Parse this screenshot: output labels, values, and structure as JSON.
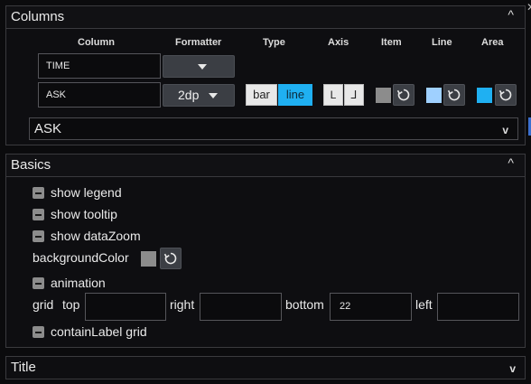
{
  "columns_panel": {
    "title": "Columns",
    "headers": {
      "column": "Column",
      "formatter": "Formatter",
      "type": "Type",
      "axis": "Axis",
      "item": "Item",
      "line": "Line",
      "area": "Area"
    },
    "rows": [
      {
        "column": "TIME",
        "formatter": ""
      },
      {
        "column": "ASK",
        "formatter": "2dp",
        "type_options": [
          "bar",
          "line"
        ],
        "type_selected": "line",
        "axis_options": [
          "L",
          "⅃"
        ],
        "item_color": "#8c8c8c",
        "line_color": "#9fd0ff",
        "area_color": "#1fb0f2"
      }
    ],
    "selected_column": "ASK"
  },
  "basics_panel": {
    "title": "Basics",
    "show_legend": "show legend",
    "show_tooltip": "show tooltip",
    "show_datazoom": "show dataZoom",
    "background_color_label": "backgroundColor",
    "background_color": "#8c8c8c",
    "animation": "animation",
    "grid_label": "grid",
    "grid_top_label": "top",
    "grid_right_label": "right",
    "grid_bottom_label": "bottom",
    "grid_left_label": "left",
    "grid_top_value": "",
    "grid_right_value": "",
    "grid_bottom_value": "22",
    "grid_left_value": "",
    "contain_label_grid": "containLabel grid"
  },
  "title_panel": {
    "title": "Title"
  },
  "icons": {
    "collapse": "^",
    "expand": "v",
    "reset": "reset-icon"
  },
  "colors": {
    "accent": "#1fb0f2",
    "background": "#0b0b0d",
    "border": "#3a3a3e"
  }
}
